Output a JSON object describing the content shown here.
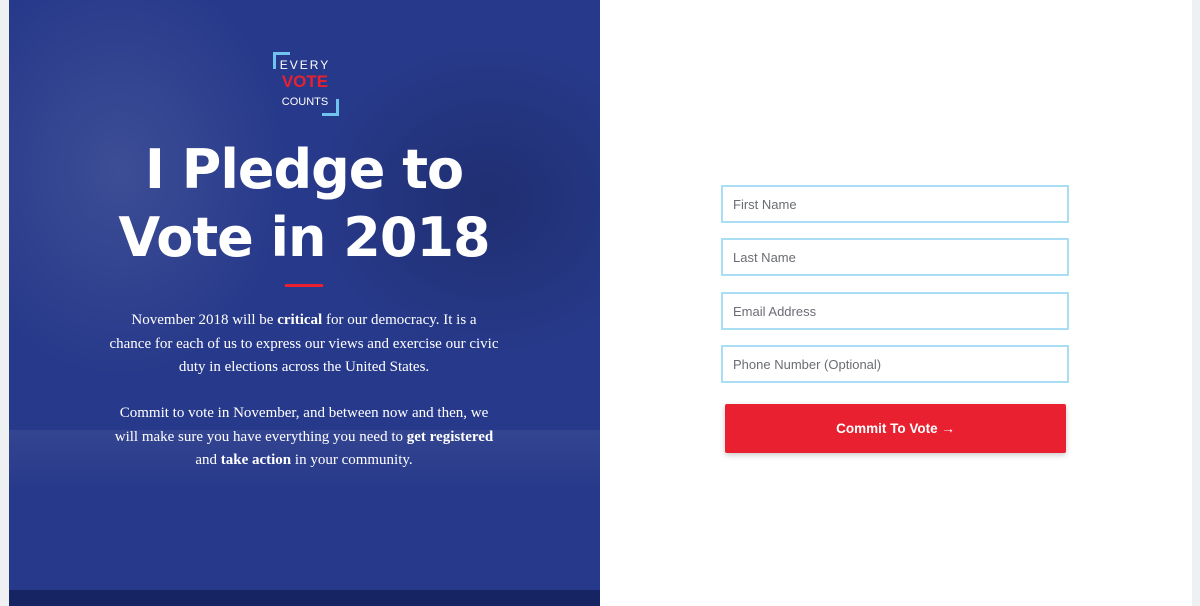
{
  "logo": {
    "line1": "EVERY",
    "line2": "VOTE",
    "line3": "COUNTS"
  },
  "hero": {
    "title_line1": "I Pledge to",
    "title_line2": "Vote in 2018",
    "p1": {
      "t1": "November 2018 will be ",
      "b1": "critical",
      "t2": " for our democracy. It is a chance for each of us to express our views and exercise our civic duty in elections across the United States."
    },
    "p2": {
      "t1": "Commit to vote in November, and between now and then, we will make sure you have everything you need to ",
      "b1": "get registered",
      "t2": " and ",
      "b2": "take action",
      "t3": " in your community."
    }
  },
  "form": {
    "first_name_placeholder": "First Name",
    "last_name_placeholder": "Last Name",
    "email_placeholder": "Email Address",
    "phone_placeholder": "Phone Number (Optional)",
    "submit_label": "Commit To Vote →"
  },
  "colors": {
    "hero_blue": "#27398a",
    "accent_red": "#e8202f",
    "field_border": "#a9def5",
    "logo_bracket": "#6ec3ef"
  }
}
